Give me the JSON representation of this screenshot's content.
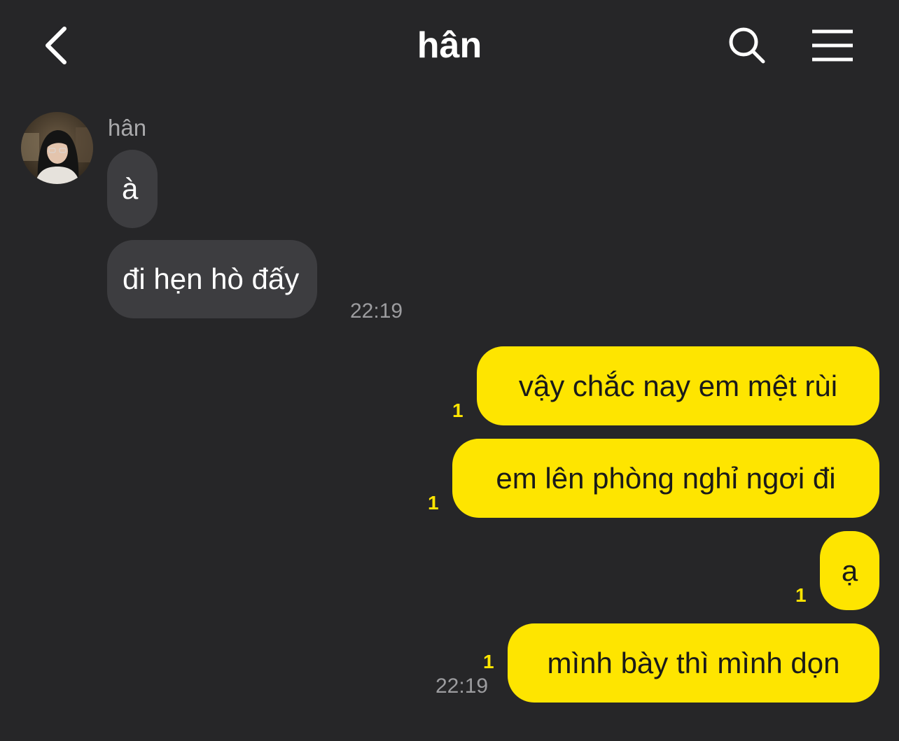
{
  "header": {
    "title": "hân"
  },
  "icons": {
    "back": "chevron-left-icon",
    "search": "search-icon",
    "menu": "hamburger-menu-icon"
  },
  "colors": {
    "background": "#262628",
    "incoming_bubble": "#3d3d40",
    "outgoing_bubble": "#fee500",
    "unread_count": "#fee500",
    "timestamp": "#9c9c9f"
  },
  "incoming": {
    "sender_name": "hân",
    "messages": [
      {
        "text": "à"
      },
      {
        "text": "đi hẹn hò đấy",
        "time": "22:19"
      }
    ]
  },
  "outgoing": {
    "messages": [
      {
        "text": "vậy chắc nay em mệt rùi",
        "unread": "1"
      },
      {
        "text": "em lên phòng nghỉ ngơi đi",
        "unread": "1"
      },
      {
        "text": "ạ",
        "unread": "1"
      },
      {
        "text": "mình bày thì mình dọn",
        "unread": "1",
        "time": "22:19"
      }
    ]
  }
}
